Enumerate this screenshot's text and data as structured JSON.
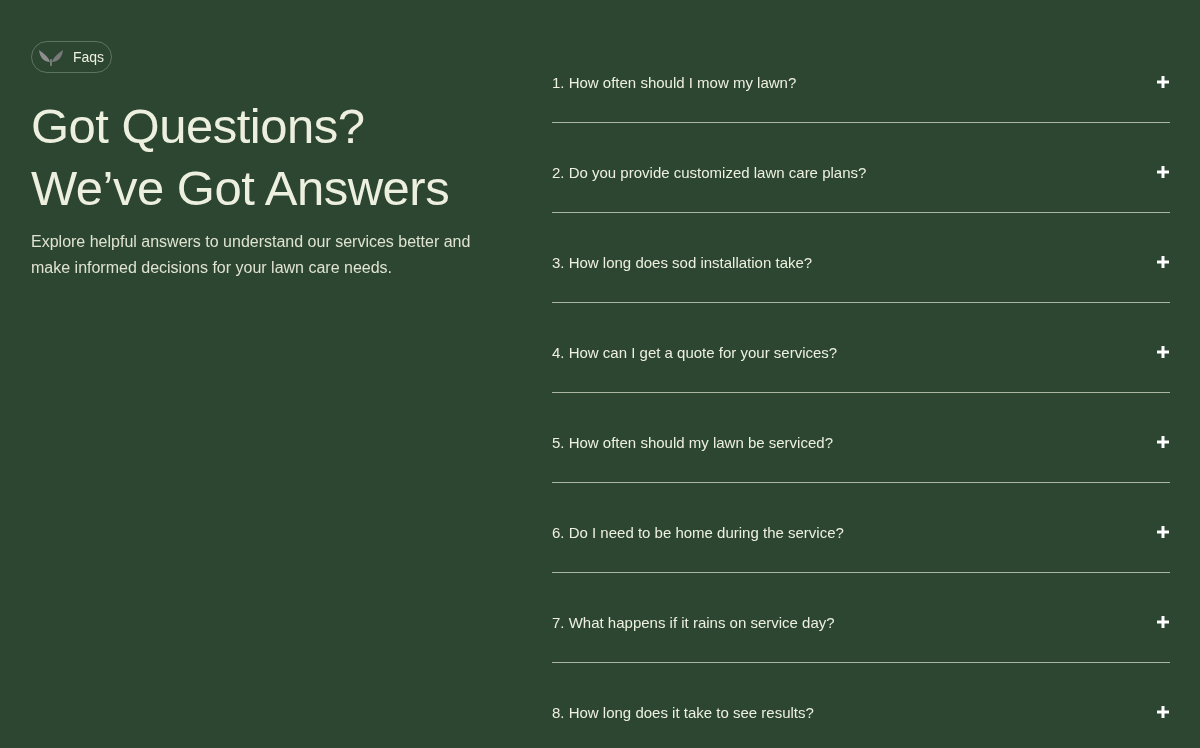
{
  "intro": {
    "badge": "Faqs",
    "title_lines": [
      "Got Questions?",
      "We’ve Got Answers"
    ],
    "description": "Explore helpful answers to understand our services better and make informed decisions for your lawn care needs."
  },
  "faqs": [
    {
      "question": "1. How often should I mow my lawn?",
      "expanded": false
    },
    {
      "question": "2. Do you provide customized lawn care plans?",
      "expanded": false
    },
    {
      "question": "3. How long does sod installation take?",
      "expanded": false
    },
    {
      "question": "4. How can I get a quote for your services?",
      "expanded": false
    },
    {
      "question": "5. How often should my lawn be serviced?",
      "expanded": false
    },
    {
      "question": "6. Do I need to be home during the service?",
      "expanded": false
    },
    {
      "question": "7. What happens if it rains on service day?",
      "expanded": false
    },
    {
      "question": "8. How long does it take to see results?",
      "expanded": false
    }
  ]
}
